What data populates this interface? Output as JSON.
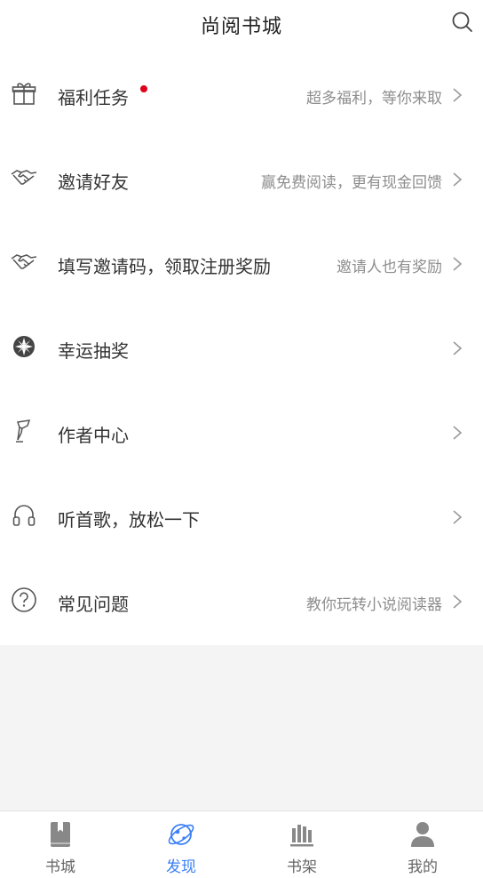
{
  "header": {
    "title": "尚阅书城",
    "search_icon": "search-icon"
  },
  "rows": [
    {
      "label": "福利任务",
      "sub": "超多福利，等你来取",
      "icon": "gift-icon",
      "badge": true
    },
    {
      "label": "邀请好友",
      "sub": "赢免费阅读，更有现金回馈",
      "icon": "handshake-icon"
    },
    {
      "label": "填写邀请码，领取注册奖励",
      "sub": "邀请人也有奖励",
      "icon": "handshake-icon"
    },
    {
      "label": "幸运抽奖",
      "sub": "",
      "icon": "lottery-wheel-icon"
    },
    {
      "label": "作者中心",
      "sub": "",
      "icon": "pen-icon"
    },
    {
      "label": "听首歌，放松一下",
      "sub": "",
      "icon": "headphones-icon"
    },
    {
      "label": "常见问题",
      "sub": "教你玩转小说阅读器",
      "icon": "question-circle-icon"
    }
  ],
  "tabbar": {
    "tabs": [
      {
        "label": "书城",
        "icon": "book-icon",
        "active": false
      },
      {
        "label": "发现",
        "icon": "planet-icon",
        "active": true
      },
      {
        "label": "书架",
        "icon": "bookshelf-icon",
        "active": false
      },
      {
        "label": "我的",
        "icon": "person-icon",
        "active": false
      }
    ]
  },
  "colors": {
    "accent": "#3a7ff6",
    "badge": "#e0001a",
    "background": "#f4f4f4"
  }
}
